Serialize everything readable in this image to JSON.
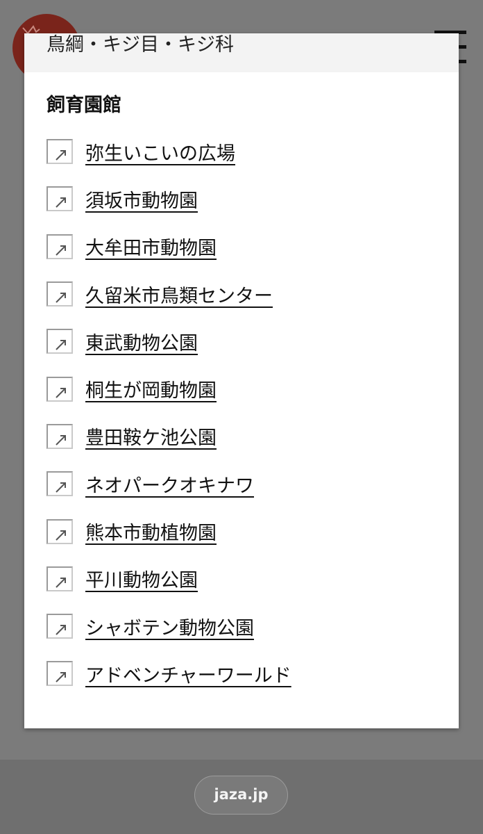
{
  "modal": {
    "breadcrumb": "鳥綱・キジ目・キジ科",
    "section_title": "飼育園館",
    "links": [
      {
        "label": "弥生いこいの広場"
      },
      {
        "label": "須坂市動物園"
      },
      {
        "label": "大牟田市動物園"
      },
      {
        "label": "久留米市鳥類センター"
      },
      {
        "label": "東武動物公園"
      },
      {
        "label": "桐生が岡動物園"
      },
      {
        "label": "豊田鞍ケ池公園"
      },
      {
        "label": "ネオパークオキナワ"
      },
      {
        "label": "熊本市動植物園"
      },
      {
        "label": "平川動物公園"
      },
      {
        "label": "シャボテン動物公園"
      },
      {
        "label": "アドベンチャーワールド"
      }
    ]
  },
  "browser": {
    "url": "jaza.jp"
  },
  "icons": {
    "background_logo": "site-logo-icon",
    "menu": "hamburger-menu-icon",
    "link_image": "broken-image-icon"
  },
  "colors": {
    "overlay": "#7b7b7b",
    "logo": "#7a241b",
    "modal_header_bg": "#f3f3f3"
  }
}
